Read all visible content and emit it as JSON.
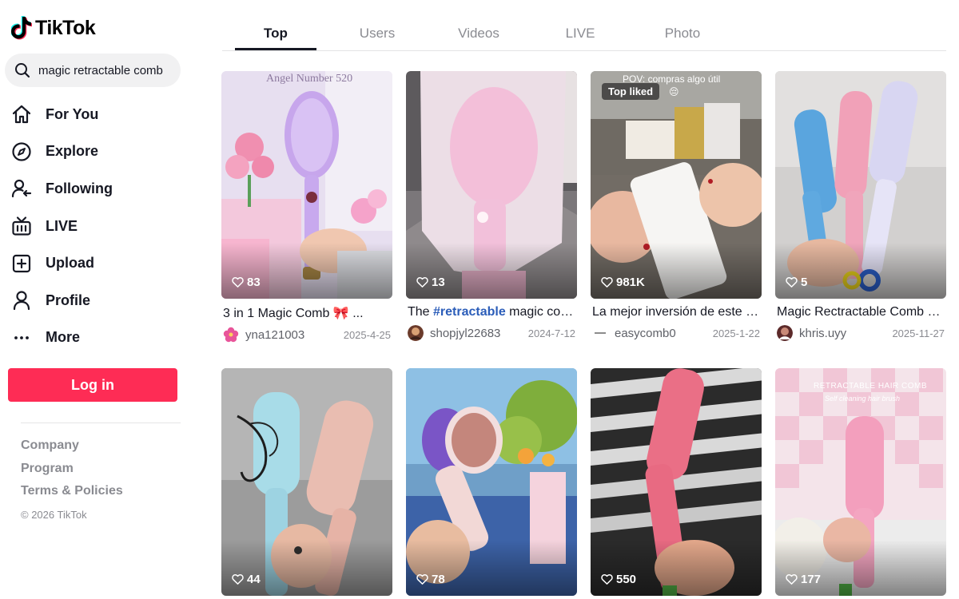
{
  "brand": {
    "name": "TikTok",
    "accent": "#fe2c55"
  },
  "search": {
    "value": "magic retractable comb",
    "placeholder": "Search"
  },
  "nav": [
    {
      "label": "For You",
      "icon": "home-icon"
    },
    {
      "label": "Explore",
      "icon": "compass-icon"
    },
    {
      "label": "Following",
      "icon": "following-icon"
    },
    {
      "label": "LIVE",
      "icon": "live-tv-icon"
    },
    {
      "label": "Upload",
      "icon": "upload-icon"
    },
    {
      "label": "Profile",
      "icon": "profile-icon"
    },
    {
      "label": "More",
      "icon": "more-icon"
    }
  ],
  "login_label": "Log in",
  "footer": {
    "links": [
      "Company",
      "Program",
      "Terms & Policies"
    ],
    "copyright": "© 2026 TikTok"
  },
  "tabs": [
    {
      "label": "Top",
      "active": true
    },
    {
      "label": "Users",
      "active": false
    },
    {
      "label": "Videos",
      "active": false
    },
    {
      "label": "LIVE",
      "active": false
    },
    {
      "label": "Photo",
      "active": false
    }
  ],
  "videos": [
    {
      "likes": "83",
      "caption": "3 in 1 Magic Comb 🎀 ...",
      "author": "yna121003",
      "date": "2025-4-25",
      "overlay": "Angel Number 520"
    },
    {
      "likes": "13",
      "caption_prefix": "The ",
      "caption_hashtag": "#retractable",
      "caption_suffix": " magic comb...",
      "author": "shopjyl22683",
      "date": "2024-7-12"
    },
    {
      "likes": "981K",
      "caption": "La mejor inversión de este año...",
      "author": "easycomb0",
      "date": "2025-1-22",
      "badge": "Top liked",
      "overlay": "POV: compras algo útil",
      "overlay_emoji": "😔"
    },
    {
      "likes": "5",
      "caption": "Magic Rectractable Comb Fo...",
      "author": "khris.uyy",
      "date": "2025-11-27"
    },
    {
      "likes": "44"
    },
    {
      "likes": "78"
    },
    {
      "likes": "550"
    },
    {
      "likes": "177",
      "overlay": "RETRACTABLE HAIR COMB",
      "overlay_sub": "Self cleaning hair brush"
    }
  ]
}
